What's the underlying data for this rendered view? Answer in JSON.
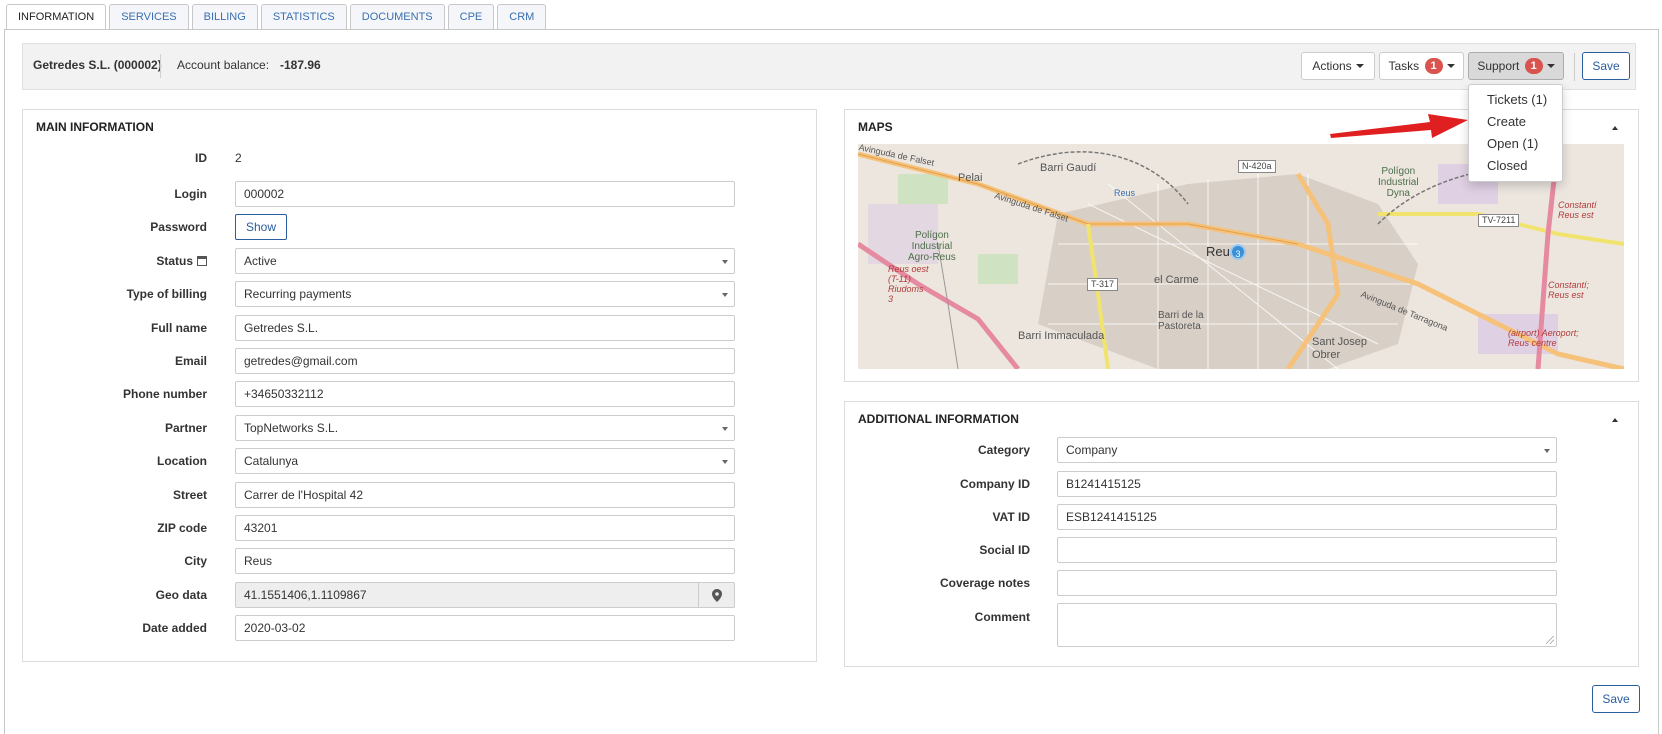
{
  "tabs": [
    "INFORMATION",
    "SERVICES",
    "BILLING",
    "STATISTICS",
    "DOCUMENTS",
    "CPE",
    "CRM"
  ],
  "active_tab": "INFORMATION",
  "topbar": {
    "account_name": "Getredes S.L. (000002)",
    "balance_label": "Account balance:",
    "balance_value": "-187.96",
    "actions_label": "Actions",
    "tasks_label": "Tasks",
    "tasks_count": "1",
    "support_label": "Support",
    "support_count": "1",
    "save_label": "Save"
  },
  "support_menu": {
    "items": [
      "Tickets (1)",
      "Create",
      "Open (1)",
      "Closed"
    ]
  },
  "main_info": {
    "title": "MAIN INFORMATION",
    "id_label": "ID",
    "id_value": "2",
    "login_label": "Login",
    "login_value": "000002",
    "password_label": "Password",
    "password_button": "Show",
    "status_label": "Status",
    "status_value": "Active",
    "billing_type_label": "Type of billing",
    "billing_type_value": "Recurring payments",
    "full_name_label": "Full name",
    "full_name_value": "Getredes S.L.",
    "email_label": "Email",
    "email_value": "getredes@gmail.com",
    "phone_label": "Phone number",
    "phone_value": "+34650332112",
    "partner_label": "Partner",
    "partner_value": "TopNetworks S.L.",
    "location_label": "Location",
    "location_value": "Catalunya",
    "street_label": "Street",
    "street_value": "Carrer de l'Hospital 42",
    "zip_label": "ZIP code",
    "zip_value": "43201",
    "city_label": "City",
    "city_value": "Reus",
    "geo_label": "Geo data",
    "geo_value": "41.1551406,1.1109867",
    "date_added_label": "Date added",
    "date_added_value": "2020-03-02"
  },
  "maps": {
    "title": "MAPS",
    "labels": {
      "pelai": "Pelai",
      "barri_gaudi": "Barri Gaudí",
      "reus_small": "Reus",
      "n420a": "N-420a",
      "poligon_dyna": "Polígon\nIndustrial\nDyna",
      "tv7211": "TV-7211",
      "constanti_reus_est": "Constantí\nReus est",
      "avinguda_falset": "Avinguda de Falset",
      "poligon_agro": "Polígon\nIndustrial\nAgro-Reus",
      "reus_oest": "Reus oest\n(T-11)\nRiudoms\n3",
      "t317": "T-317",
      "el_carme": "el Carme",
      "reus_big": "Reus",
      "cluster": "3",
      "constanti_reus_est2": "Constantí;\nReus est",
      "barri_pastoreta": "Barri de la\nPastoreta",
      "barri_immaculada": "Barri Immaculada",
      "avinguda_tarragona": "Avinguda de Tarragona",
      "sant_josep": "Sant Josep\nObrer",
      "aeroport": "(airport) Aeroport;\nReus centre",
      "avinguda_falset_left": "Avinguda de Falset"
    }
  },
  "additional_info": {
    "title": "ADDITIONAL INFORMATION",
    "category_label": "Category",
    "category_value": "Company",
    "company_id_label": "Company ID",
    "company_id_value": "B1241415125",
    "vat_id_label": "VAT ID",
    "vat_id_value": "ESB1241415125",
    "social_id_label": "Social ID",
    "social_id_value": "",
    "coverage_label": "Coverage notes",
    "coverage_value": "",
    "comment_label": "Comment",
    "comment_value": ""
  },
  "bottom_save_label": "Save",
  "colors": {
    "accent_blue": "#2a5d9f",
    "badge_red": "#d9534f",
    "arrow_red": "#e02020"
  }
}
